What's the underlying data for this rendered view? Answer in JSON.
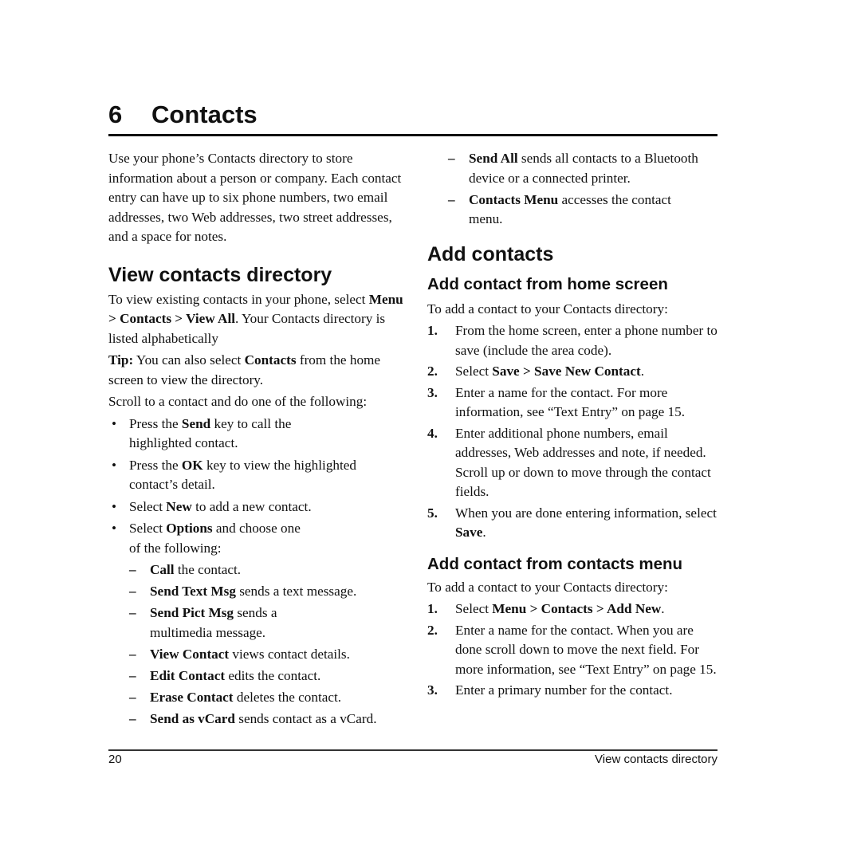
{
  "chapter": {
    "number": "6",
    "title": "Contacts"
  },
  "intro": "Use your phone’s Contacts directory to store information about a person or company. Each contact entry can have up to six phone numbers, two email addresses, two Web addresses, two street addresses, and a space for notes.",
  "view_section": {
    "heading": "View contacts directory",
    "para1": {
      "pre": "To view existing contacts in your phone, select ",
      "path": "Menu > Contacts > View All",
      "post": ". Your Contacts directory is listed alphabetically"
    },
    "tip": {
      "label": "Tip:",
      "pre": " You can also select ",
      "bold": "Contacts",
      "post": " from the home screen to view the directory."
    },
    "scroll_text": "Scroll to a contact and do one of the following:",
    "bullets": [
      {
        "pre": "Press the ",
        "bold": "Send",
        "post": " key to call the highlighted contact."
      },
      {
        "pre": "Press the ",
        "bold": "OK",
        "post": " key to view the highlighted contact’s detail."
      },
      {
        "pre": "Select ",
        "bold": "New",
        "post": " to add a new contact."
      },
      {
        "pre": "Select ",
        "bold": "Options",
        "post": " and choose one of the following:"
      }
    ],
    "options": [
      {
        "bold": "Call",
        "post": " the contact."
      },
      {
        "bold": "Send Text Msg",
        "post": " sends a text message."
      },
      {
        "bold": "Send Pict Msg",
        "post": " sends a multimedia message."
      },
      {
        "bold": "View Contact",
        "post": " views contact details."
      },
      {
        "bold": "Edit Contact",
        "post": " edits the contact."
      },
      {
        "bold": "Erase Contact",
        "post": " deletes the contact."
      },
      {
        "bold": "Send as vCard",
        "post": " sends contact as a vCard."
      },
      {
        "bold": "Send All",
        "post": " sends all contacts to a Bluetooth device or a connected printer."
      },
      {
        "bold": "Contacts Menu",
        "post": " accesses the contact menu."
      }
    ]
  },
  "add_section": {
    "heading": "Add contacts",
    "home": {
      "heading": "Add contact from home screen",
      "intro": "To add a contact to your Contacts directory:",
      "steps": [
        {
          "num": "1.",
          "pre": "From the home screen, enter a phone number to save (include the area code).",
          "bold": "",
          "post": ""
        },
        {
          "num": "2.",
          "pre": "Select ",
          "bold": "Save > Save New Contact",
          "post": "."
        },
        {
          "num": "3.",
          "pre": "Enter a name for the contact. For more information, see “Text Entry” on page 15.",
          "bold": "",
          "post": ""
        },
        {
          "num": "4.",
          "pre": "Enter additional phone numbers, email addresses, Web addresses and note, if needed. Scroll up or down to move through the contact fields.",
          "bold": "",
          "post": ""
        },
        {
          "num": "5.",
          "pre": "When you are done entering information, select ",
          "bold": "Save",
          "post": "."
        }
      ]
    },
    "menu": {
      "heading": "Add contact from contacts menu",
      "intro": "To add a contact to your Contacts directory:",
      "steps": [
        {
          "num": "1.",
          "pre": "Select ",
          "bold": "Menu > Contacts > Add New",
          "post": "."
        },
        {
          "num": "2.",
          "pre": "Enter a name for the contact. When you are done scroll down to move the next field. For more information, see “Text Entry” on page 15.",
          "bold": "",
          "post": ""
        },
        {
          "num": "3.",
          "pre": "Enter a primary number for the contact.",
          "bold": "",
          "post": ""
        }
      ]
    }
  },
  "footer": {
    "page_number": "20",
    "section": "View contacts directory"
  },
  "glyphs": {
    "bullet": "•",
    "dash": "–"
  }
}
